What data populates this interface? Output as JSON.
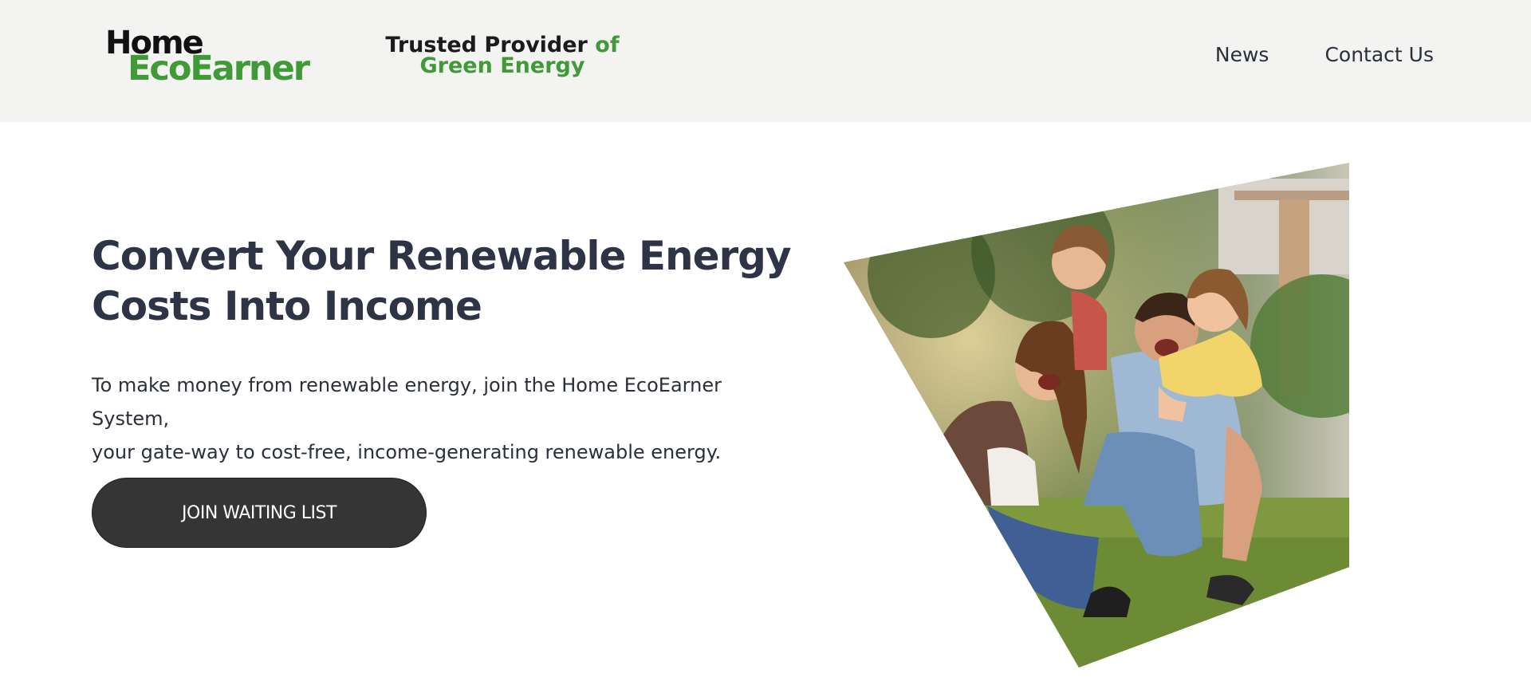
{
  "header": {
    "logo": {
      "line1": "Home",
      "line2": "EcoEarner"
    },
    "tagline": {
      "part1": "Trusted Provider",
      "part2": "of",
      "line2": "Green Energy"
    },
    "nav": [
      {
        "label": "News"
      },
      {
        "label": "Contact Us"
      }
    ]
  },
  "hero": {
    "title_line1": "Convert Your Renewable Energy",
    "title_line2": "Costs Into Income",
    "description_line1": "To make money from renewable energy, join the Home EcoEarner System,",
    "description_line2": "your gate-way to cost-free, income-generating renewable energy.",
    "cta_label": "JOIN WAITING LIST"
  },
  "colors": {
    "header_bg": "#f3f3f1",
    "brand_green": "#3f9a37",
    "heading": "#2e3446",
    "button_bg": "#353535"
  }
}
